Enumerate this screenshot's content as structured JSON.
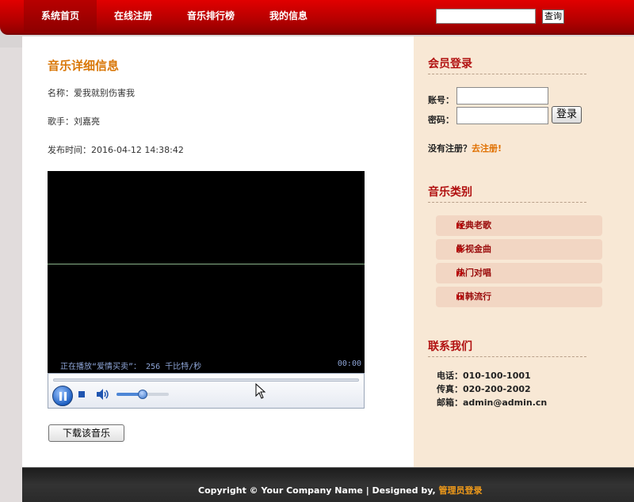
{
  "nav": {
    "items": [
      {
        "label": "系统首页",
        "active": true
      },
      {
        "label": "在线注册",
        "active": false
      },
      {
        "label": "音乐排行榜",
        "active": false
      },
      {
        "label": "我的信息",
        "active": false
      }
    ],
    "search_button": "查询",
    "search_value": ""
  },
  "detail": {
    "title": "音乐详细信息",
    "name_line": "名称：爱我就别伤害我",
    "singer_line": "歌手：刘嘉亮",
    "time_line": "发布时间：2016-04-12 14:38:42"
  },
  "player": {
    "status": "正在播放“爱情买卖”： 256  千比特/秒",
    "time": "00:00",
    "volume": 0.5,
    "progress": 0
  },
  "download_button": "下载该音乐",
  "sidebar": {
    "login_title": "会员登录",
    "account_label": "账号：",
    "password_label": "密码：",
    "login_button": "登录",
    "register_prompt": "没有注册？",
    "register_link": "去注册!",
    "category_title": "音乐类别",
    "categories": [
      "经典老歌",
      "影视金曲",
      "热门对唱",
      "日韩流行"
    ],
    "contact_title": "联系我们",
    "phone": "电话：010-100-1001",
    "fax": "传真：020-200-2002",
    "email": "邮箱：admin@admin.cn"
  },
  "footer": {
    "text": "Copyright © Your Company Name | Designed by, ",
    "link": "管理员登录"
  },
  "colors": {
    "nav_red": "#c40000",
    "title_orange": "#d97708",
    "sidebar_title_red": "#b11010",
    "sidebar_bg": "#f8e8d5",
    "footer_link": "#f09a1a"
  }
}
